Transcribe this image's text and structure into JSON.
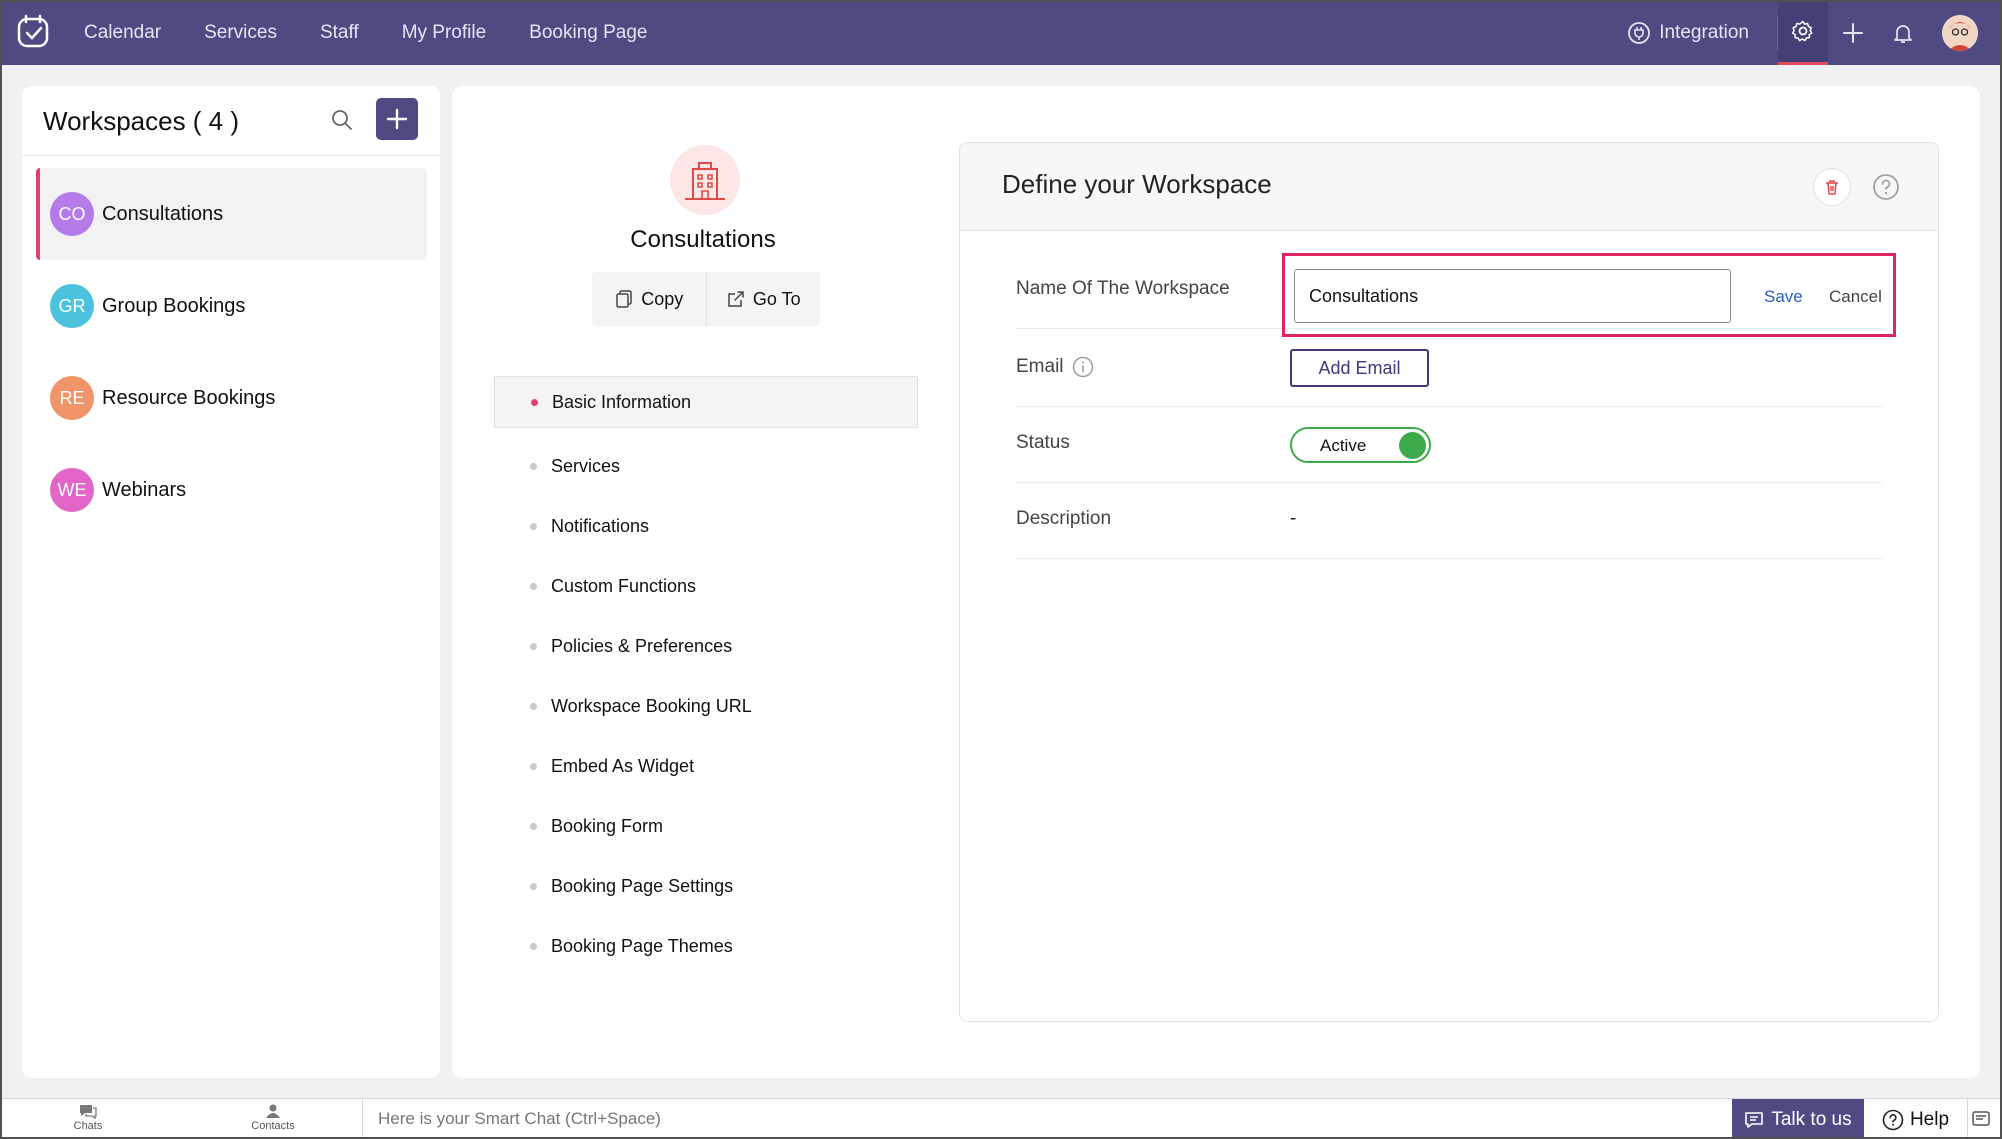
{
  "topbar": {
    "nav": [
      "Calendar",
      "Services",
      "Staff",
      "My Profile",
      "Booking Page"
    ],
    "integration_label": "Integration",
    "icons": [
      "settings-icon",
      "plus-icon",
      "bell-icon",
      "user-avatar"
    ]
  },
  "workspaces": {
    "title": "Workspaces ( 4 )",
    "items": [
      {
        "initials": "CO",
        "name": "Consultations",
        "color": "#b57be8",
        "selected": true
      },
      {
        "initials": "GR",
        "name": "Group Bookings",
        "color": "#4cc3de",
        "selected": false
      },
      {
        "initials": "RE",
        "name": "Resource Bookings",
        "color": "#f0956a",
        "selected": false
      },
      {
        "initials": "WE",
        "name": "Webinars",
        "color": "#e265c8",
        "selected": false
      }
    ]
  },
  "workspace_detail": {
    "name": "Consultations",
    "copy_label": "Copy",
    "goto_label": "Go To",
    "menu": [
      "Basic Information",
      "Services",
      "Notifications",
      "Custom Functions",
      "Policies & Preferences",
      "Workspace Booking URL",
      "Embed As Widget",
      "Booking Form",
      "Booking Page Settings",
      "Booking Page Themes"
    ],
    "active_menu": "Basic Information"
  },
  "define": {
    "title": "Define your Workspace",
    "name_label": "Name Of The Workspace",
    "name_value": "Consultations",
    "save_label": "Save",
    "cancel_label": "Cancel",
    "email_label": "Email",
    "add_email_label": "Add Email",
    "status_label": "Status",
    "status_value": "Active",
    "description_label": "Description",
    "description_value": "-"
  },
  "bottombar": {
    "chats_label": "Chats",
    "contacts_label": "Contacts",
    "smartchat_placeholder": "Here is your Smart Chat (Ctrl+Space)",
    "talk_label": "Talk to us",
    "help_label": "Help"
  },
  "colors": {
    "brand": "#4f4a82",
    "accent": "#e43f6f",
    "highlight": "#e0245e",
    "active_green": "#3bab4a"
  }
}
